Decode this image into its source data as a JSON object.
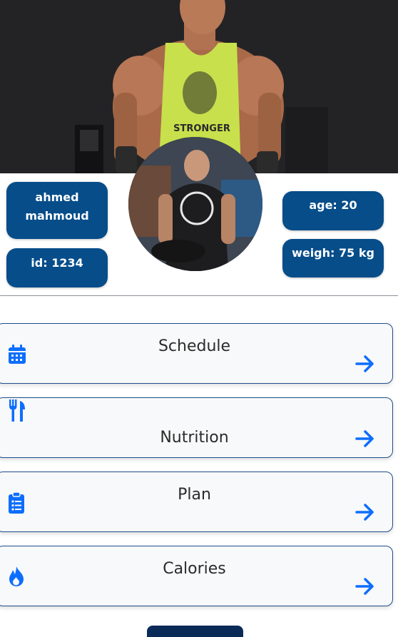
{
  "profile": {
    "name": "ahmed mahmoud",
    "id_label": "id: 1234",
    "age_label": "age: 20",
    "weight_label": "weigh: 75 kg"
  },
  "hero_shirt_text": "STRONGER",
  "menu": [
    {
      "label": "Schedule",
      "icon": "calendar-icon"
    },
    {
      "label": "Nutrition",
      "icon": "utensils-icon"
    },
    {
      "label": "Plan",
      "icon": "clipboard-list-icon"
    },
    {
      "label": "Calories",
      "icon": "fire-icon"
    }
  ],
  "colors": {
    "pill": "#064d8a",
    "accent": "#0d6efd",
    "card_border": "#1f4e8c",
    "bottom_button": "#0a2a57"
  }
}
